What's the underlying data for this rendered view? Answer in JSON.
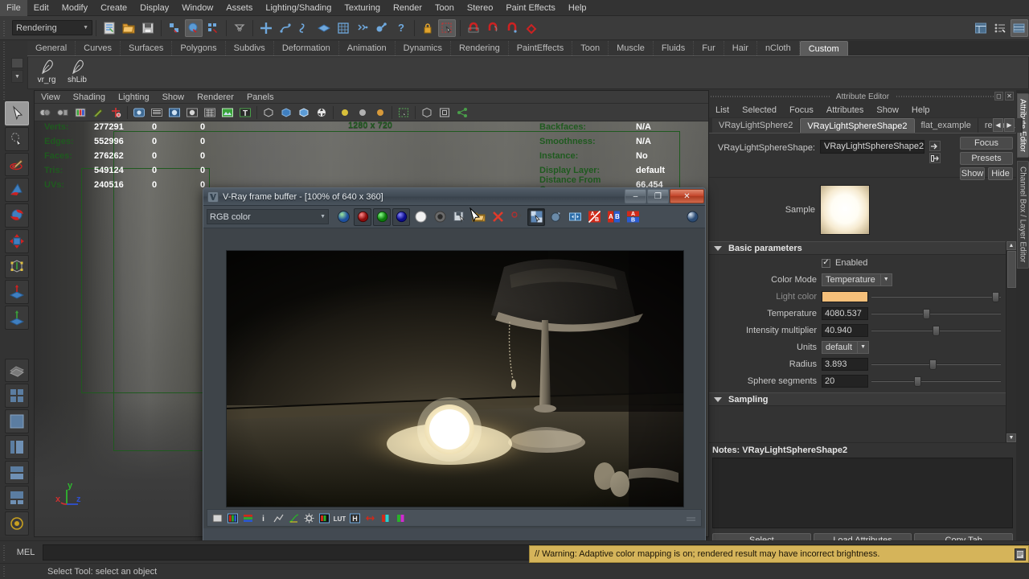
{
  "app": {
    "menubar": [
      "File",
      "Edit",
      "Modify",
      "Create",
      "Display",
      "Window",
      "Assets",
      "Lighting/Shading",
      "Texturing",
      "Render",
      "Toon",
      "Stereo",
      "Paint Effects",
      "Help"
    ],
    "mode_selector": "Rendering"
  },
  "shelf": {
    "tabs": [
      "General",
      "Curves",
      "Surfaces",
      "Polygons",
      "Subdivs",
      "Deformation",
      "Animation",
      "Dynamics",
      "Rendering",
      "PaintEffects",
      "Toon",
      "Muscle",
      "Fluids",
      "Fur",
      "Hair",
      "nCloth",
      "Custom"
    ],
    "active_tab": "Custom",
    "items": [
      {
        "label": "vr_rg",
        "icon": "feather-icon"
      },
      {
        "label": "shLib",
        "icon": "feather-icon"
      }
    ]
  },
  "viewport": {
    "menus": [
      "View",
      "Shading",
      "Lighting",
      "Show",
      "Renderer",
      "Panels"
    ],
    "resolution_gate_label": "1280 x 720",
    "axis_labels": {
      "x": "x",
      "y": "y",
      "z": "z"
    },
    "stats_left": {
      "headers": [
        "",
        "",
        "",
        ""
      ],
      "rows": [
        {
          "label": "Verts:",
          "c1": "277291",
          "c2": "0",
          "c3": "0"
        },
        {
          "label": "Edges:",
          "c1": "552996",
          "c2": "0",
          "c3": "0"
        },
        {
          "label": "Faces:",
          "c1": "276262",
          "c2": "0",
          "c3": "0"
        },
        {
          "label": "Tris:",
          "c1": "549124",
          "c2": "0",
          "c3": "0"
        },
        {
          "label": "UVs:",
          "c1": "240516",
          "c2": "0",
          "c3": "0"
        }
      ]
    },
    "stats_right": [
      {
        "label": "Backfaces:",
        "value": "N/A"
      },
      {
        "label": "Smoothness:",
        "value": "N/A"
      },
      {
        "label": "Instance:",
        "value": "No"
      },
      {
        "label": "Display Layer:",
        "value": "default"
      },
      {
        "label": "Distance From Camera:",
        "value": "66.454"
      }
    ]
  },
  "vfb": {
    "title": "V-Ray frame buffer - [100% of 640 x 360]",
    "channel_select": "RGB color",
    "window_buttons": {
      "minimize": "–",
      "maximize": "❐",
      "close": "✕"
    }
  },
  "attribute_editor": {
    "panel_title": "Attribute Editor",
    "menus": [
      "List",
      "Selected",
      "Focus",
      "Attributes",
      "Show",
      "Help"
    ],
    "tabs": [
      "VRayLightSphere2",
      "VRayLightSphereShape2",
      "flat_example",
      "renderL"
    ],
    "active_tab": "VRayLightSphereShape2",
    "node_label": "VRayLightSphereShape:",
    "node_value": "VRayLightSphereShape2",
    "buttons": {
      "focus": "Focus",
      "presets": "Presets",
      "show": "Show",
      "hide": "Hide"
    },
    "sample_label": "Sample",
    "sections": [
      {
        "name": "Basic parameters",
        "expanded": true,
        "enabled_label": "Enabled",
        "enabled_checked": true,
        "fields": [
          {
            "label": "Color Mode",
            "type": "combo",
            "value": "Temperature",
            "dim": false
          },
          {
            "label": "Light color",
            "type": "color",
            "value": "#f6c07a",
            "dim": true,
            "slider": 0.93
          },
          {
            "label": "Temperature",
            "type": "number",
            "value": "4080.537",
            "dim": false,
            "slider": 0.4
          },
          {
            "label": "Intensity multiplier",
            "type": "number",
            "value": "40.940",
            "dim": false,
            "slider": 0.47
          },
          {
            "label": "Units",
            "type": "combo",
            "value": "default",
            "dim": false
          },
          {
            "label": "Radius",
            "type": "number",
            "value": "3.893",
            "dim": false,
            "slider": 0.45
          },
          {
            "label": "Sphere segments",
            "type": "number",
            "value": "20",
            "dim": false,
            "slider": 0.33
          }
        ]
      },
      {
        "name": "Sampling",
        "expanded": true,
        "fields": []
      }
    ],
    "notes_label": "Notes:",
    "notes_value": "VRayLightSphereShape2",
    "footer_buttons": [
      "Select",
      "Load Attributes",
      "Copy Tab"
    ],
    "side_tabs": [
      "Attribute Editor",
      "Channel Box / Layer Editor"
    ],
    "active_side_tab": "Attribute Editor"
  },
  "bottom": {
    "mel_label": "MEL",
    "mel_value": "",
    "warning": "// Warning: Adaptive color mapping is on; rendered result may have incorrect brightness.",
    "help_text": "Select Tool: select an object"
  }
}
